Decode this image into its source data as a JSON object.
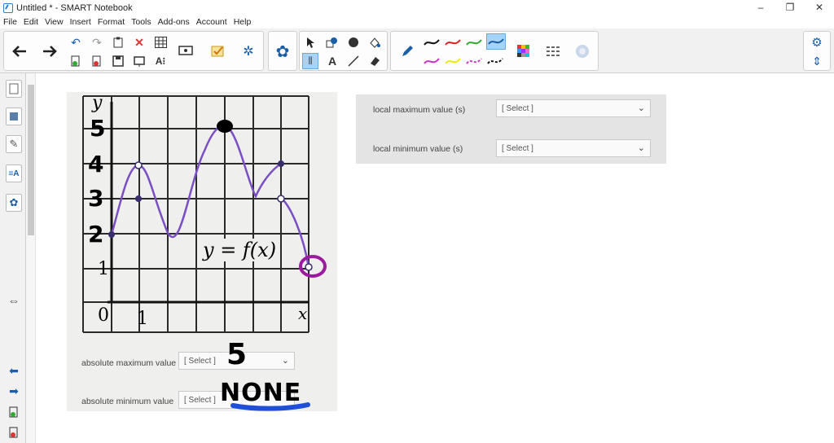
{
  "window": {
    "title": "Untitled * - SMART Notebook",
    "controls": [
      "–",
      "❐",
      "✕"
    ]
  },
  "menu": [
    "File",
    "Edit",
    "View",
    "Insert",
    "Format",
    "Tools",
    "Add-ons",
    "Account",
    "Help"
  ],
  "colors": {
    "accent": "#2a7fd4",
    "selected_tool": "#a9d3f5",
    "graph_curve": "#7b4fc4",
    "annotation_purple": "#9b1a9e",
    "underline_blue": "#1f4fd8"
  },
  "graph": {
    "axis_y": "y",
    "axis_x": "x",
    "origin": "0",
    "tick_x1": "1",
    "tick_y1": "1",
    "function_label": "y = f(x)",
    "handwritten_y_labels": [
      "5",
      "4",
      "3",
      "2"
    ]
  },
  "quiz_left": {
    "abs_max_label": "absolute maximum value",
    "abs_max_select": "[ Select ]",
    "abs_min_label": "absolute minimum value",
    "abs_min_select": "[ Select ]",
    "handwritten_max_answer": "5",
    "handwritten_min_answer": "NONE"
  },
  "quiz_right": {
    "local_max_label": "local maximum value (s)",
    "local_max_select": "[ Select ]",
    "local_min_label": "local minimum value (s)",
    "local_min_select": "[ Select ]"
  }
}
